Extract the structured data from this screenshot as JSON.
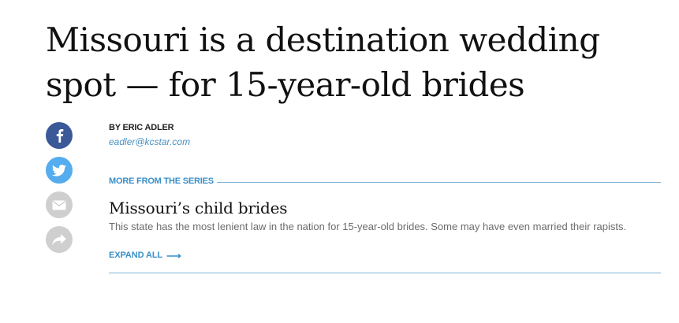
{
  "article": {
    "headline": "Missouri is a destination wedding spot — for 15-year-old brides"
  },
  "share": {
    "buttons": [
      {
        "icon": "facebook-icon",
        "color": "#3b5998"
      },
      {
        "icon": "twitter-icon",
        "color": "#55acee"
      },
      {
        "icon": "email-icon",
        "color": "#cfcfcf"
      },
      {
        "icon": "share-arrow-icon",
        "color": "#cfcfcf"
      }
    ]
  },
  "byline": {
    "author": "BY ERIC ADLER",
    "email": "eadler@kcstar.com"
  },
  "series": {
    "label": "MORE FROM THE SERIES",
    "title": "Missouri’s child brides",
    "description": "This state has the most lenient law in the nation for 15-year-old brides. Some may have even married their rapists.",
    "expand_label": "EXPAND ALL",
    "expand_arrow": "⟶"
  },
  "colors": {
    "accent": "#3a8fc7",
    "rule": "#7fb3d8",
    "text": "#111111",
    "muted": "#6b6b6b"
  }
}
